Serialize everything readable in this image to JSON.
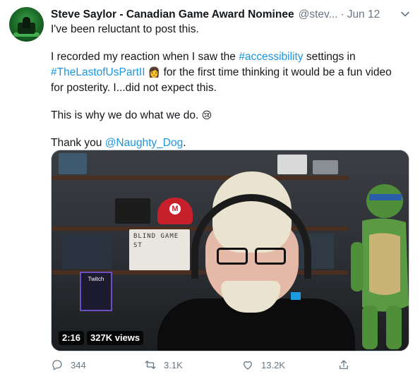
{
  "tweet": {
    "author_name": "Steve Saylor - Canadian Game Award Nominee",
    "author_handle": "@stev...",
    "separator": "·",
    "date": "Jun 12",
    "lines": {
      "p1": "I've been reluctant to post this.",
      "p2_a": "I recorded my reaction when I saw the ",
      "p2_hashtag1": "#accessibility",
      "p2_b": " settings in",
      "p2_hashtag2": "#TheLastofUsPartII",
      "p2_emoji": "👩",
      "p2_c": " for the first time thinking it would be a fun video for posterity. I...did not expect this.",
      "p3": "This is why we do what we do. ",
      "p3_emoji": "😢",
      "p4_a": "Thank you ",
      "p4_mention": "@Naughty_Dog",
      "p4_b": "."
    },
    "media": {
      "duration": "2:16",
      "views": "327K views",
      "sign_text": "BLIND GAME ST",
      "twitch_text": "Twitch"
    },
    "actions": {
      "replies": "344",
      "retweets": "3.1K",
      "likes": "13.2K"
    }
  },
  "colors": {
    "link": "#1b95e0",
    "secondary": "#657786",
    "text": "#14171a"
  }
}
